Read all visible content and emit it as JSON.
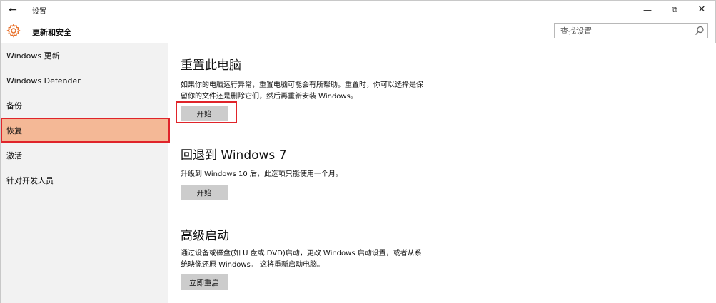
{
  "titlebar": {
    "back_icon": "back-arrow-icon",
    "title": "设置",
    "min_glyph": "—",
    "max_glyph": "⧉",
    "close_glyph": "✕"
  },
  "header": {
    "icon": "gear-icon",
    "title": "更新和安全",
    "accent_color": "#e8702a",
    "search_placeholder": "查找设置",
    "search_value": "",
    "search_icon": "search-icon"
  },
  "sidebar": {
    "items": [
      {
        "label": "Windows 更新"
      },
      {
        "label": "Windows Defender"
      },
      {
        "label": "备份"
      },
      {
        "label": "恢复",
        "selected": true
      },
      {
        "label": "激活"
      },
      {
        "label": "针对开发人员"
      }
    ],
    "selected_color": "#f4b896"
  },
  "main": {
    "sections": [
      {
        "title": "重置此电脑",
        "description": "如果你的电脑运行异常，重置电脑可能会有所帮助。重置时，你可以选择是保留你的文件还是删除它们，然后再重新安装 Windows。",
        "button": "开始"
      },
      {
        "title": "回退到 Windows 7",
        "description": "升级到 Windows 10 后，此选项只能使用一个月。",
        "button": "开始"
      },
      {
        "title": "高级启动",
        "description": "通过设备或磁盘(如 U 盘或 DVD)启动，更改 Windows 启动设置，或者从系统映像还原 Windows。 这将重新启动电脑。",
        "button": "立即重启"
      }
    ]
  },
  "annotation_color": "#e0242a"
}
